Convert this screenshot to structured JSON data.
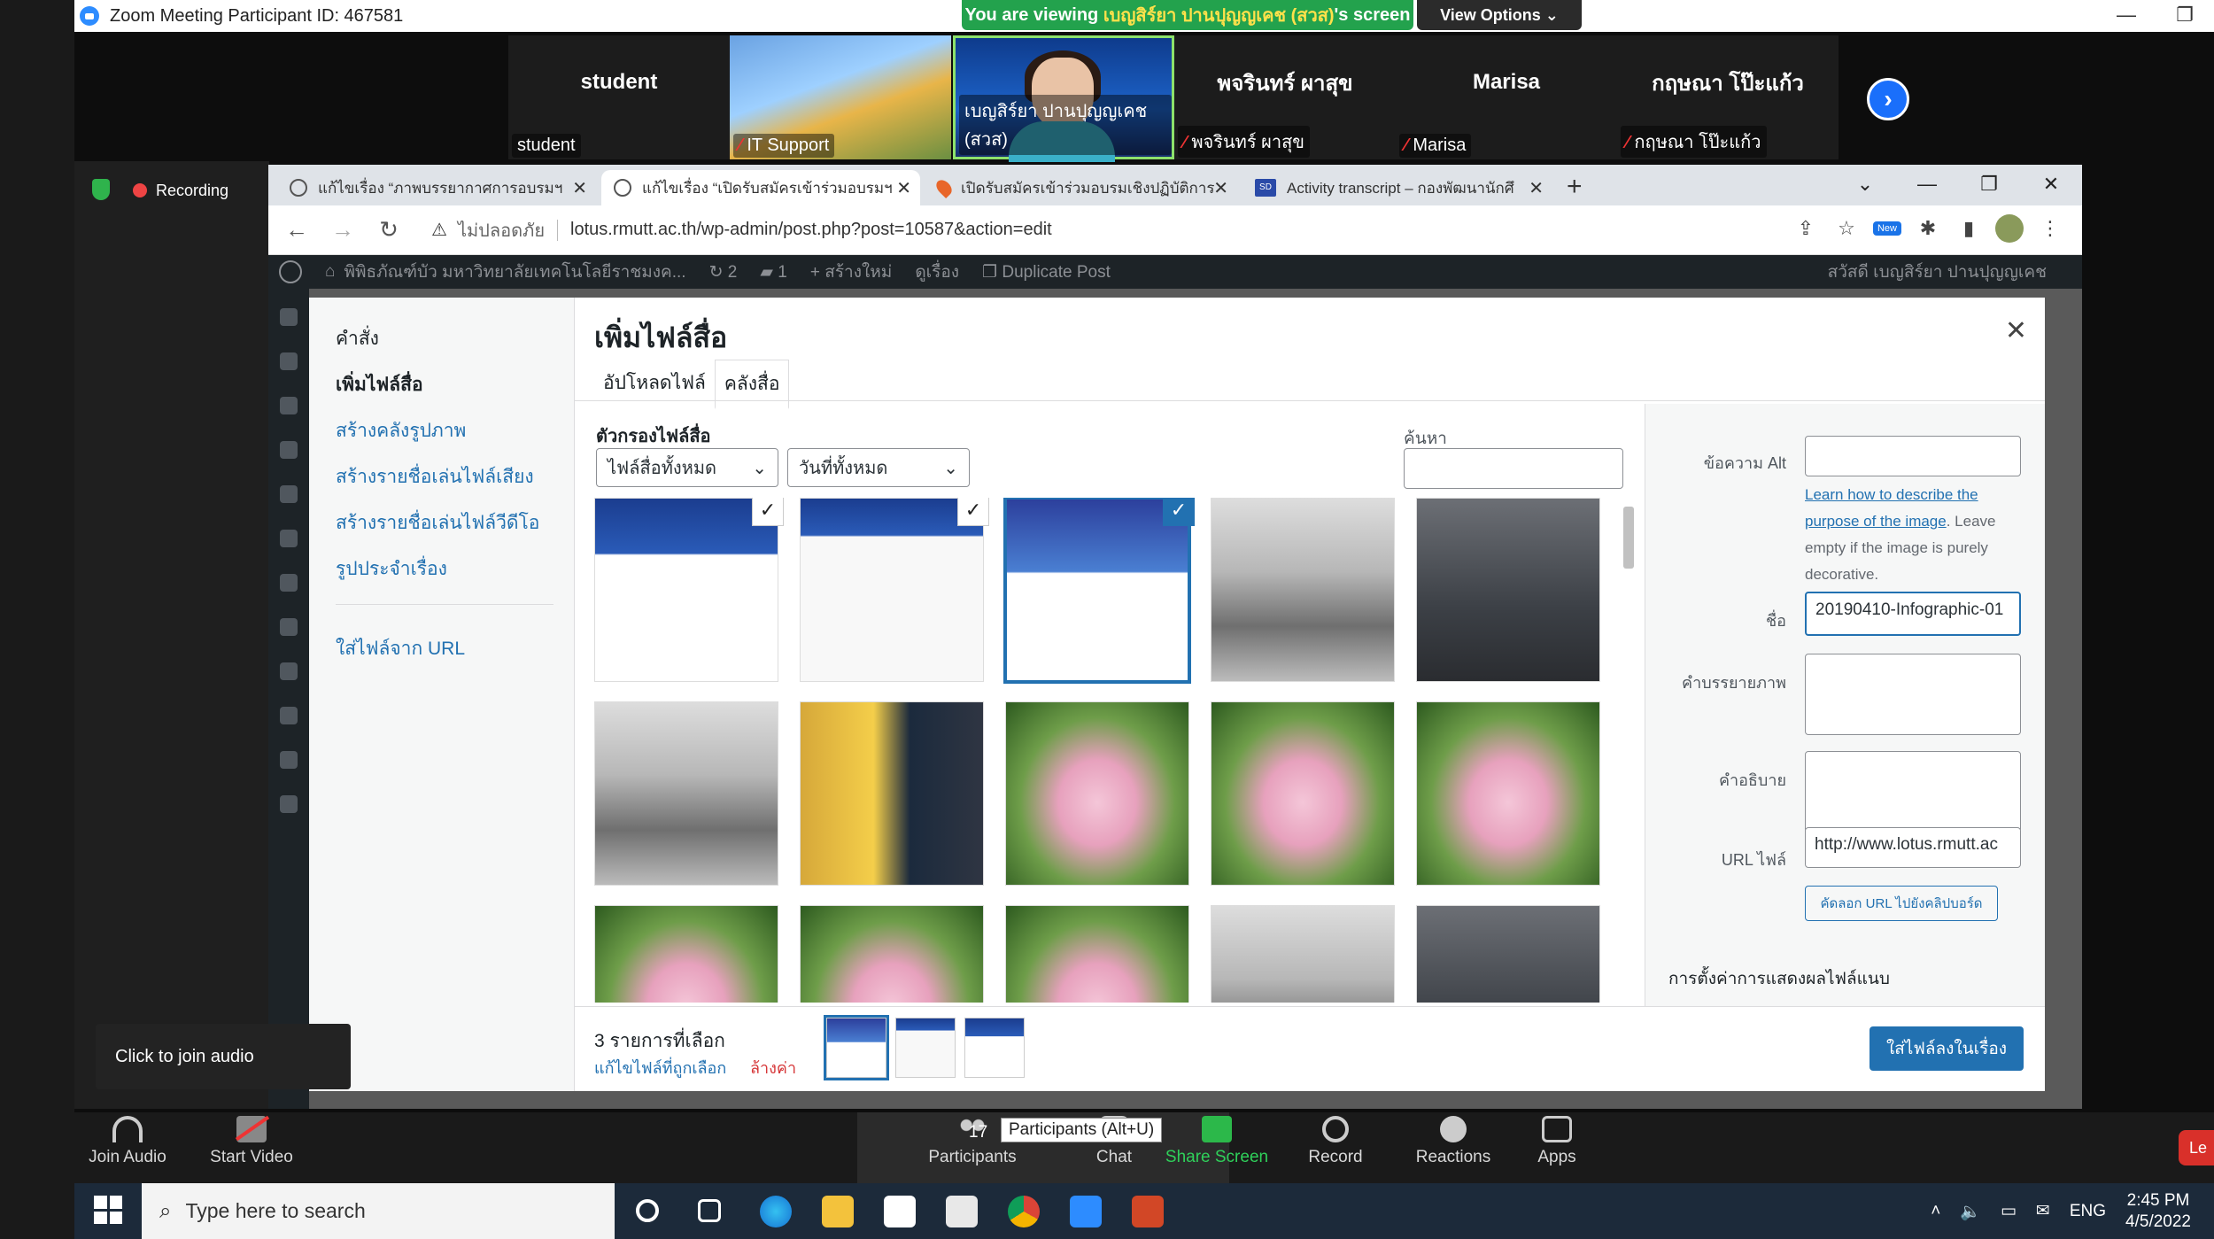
{
  "zoom": {
    "title": "Zoom Meeting Participant ID: 467581",
    "banner_prefix": "You are viewing",
    "banner_name": "เบญสิร์ยา ปานปุญญเคช (สวส)",
    "banner_suffix": "screen",
    "view_options": "View Options ⌄",
    "recording": "Recording",
    "participants": [
      {
        "big": "student",
        "label": "student"
      },
      {
        "big": "",
        "label": "IT Support"
      },
      {
        "big": "",
        "label": "เบญสิร์ยา ปานปุญญเคช (สวส)"
      },
      {
        "big": "พจรินทร์ ผาสุข",
        "label": "พจรินทร์ ผาสุข"
      },
      {
        "big": "Marisa",
        "label": "Marisa"
      },
      {
        "big": "กฤษณา โป๊ะแก้ว",
        "label": "กฤษณา โป๊ะแก้ว"
      }
    ],
    "join_tip": "Click to join audio",
    "toolbar": {
      "join_audio": "Join Audio",
      "start_video": "Start Video",
      "participants": "Participants",
      "participants_count": "17",
      "participants_tip": "Participants (Alt+U)",
      "chat": "Chat",
      "share": "Share Screen",
      "record": "Record",
      "reactions": "Reactions",
      "apps": "Apps",
      "leave": "Le"
    }
  },
  "browser": {
    "tabs": [
      {
        "title": "แก้ไขเรื่อง “ภาพบรรยากาศการอบรมฯ"
      },
      {
        "title": "แก้ไขเรื่อง “เปิดรับสมัครเข้าร่วมอบรมฯ"
      },
      {
        "title": "เปิดรับสมัครเข้าร่วมอบรมเชิงปฏิบัติการ"
      },
      {
        "title": "Activity transcript – กองพัฒนานักศึ"
      }
    ],
    "insecure": "ไม่ปลอดภัย",
    "url": "lotus.rmutt.ac.th/wp-admin/post.php?post=10587&action=edit",
    "new_badge": "New"
  },
  "wp": {
    "adminbar": {
      "site": "พิพิธภัณฑ์บัว มหาวิทยาลัยเทคโนโลยีราชมงค...",
      "updates": "2",
      "comments": "1",
      "new": "สร้างใหม่",
      "view": "ดูเรื่อง",
      "duplicate": "Duplicate Post",
      "greeting": "สวัสดี เบญสิร์ยา ปานปุญญเคช"
    },
    "modal": {
      "actions_heading": "คำสั่ง",
      "menu": [
        "เพิ่มไฟล์สื่อ",
        "สร้างคลังรูปภาพ",
        "สร้างรายชื่อเล่นไฟล์เสียง",
        "สร้างรายชื่อเล่นไฟล์วีดีโอ",
        "รูปประจำเรื่อง"
      ],
      "from_url": "ใส่ไฟล์จาก URL",
      "title": "เพิ่มไฟล์สื่อ",
      "tab_upload": "อัปโหลดไฟล์",
      "tab_library": "คลังสื่อ",
      "filter_label": "ตัวกรองไฟล์สื่อ",
      "filter_type": "ไฟล์สื่อทั้งหมด",
      "filter_date": "วันที่ทั้งหมด",
      "search_label": "ค้นหา",
      "details": {
        "alt_label": "ข้อความ Alt",
        "alt_help_link1": "Learn how to describe the",
        "alt_help_link2": "purpose of the image",
        "alt_help_rest": ". Leave empty if the image is purely decorative.",
        "title_label": "ชื่อ",
        "title_value": "20190410-Infographic-01",
        "caption_label": "คำบรรยายภาพ",
        "desc_label": "คำอธิบาย",
        "url_label": "URL ไฟล์",
        "url_value": "http://www.lotus.rmutt.ac",
        "copy_button": "คัดลอก URL ไปยังคลิปบอร์ด",
        "settings_heading": "การตั้งค่าการแสดงผลไฟล์แนบ"
      },
      "selection_count": "3 รายการที่เลือก",
      "edit_selection": "แก้ไขไฟล์ที่ถูกเลือก",
      "clear": "ล้างค่า",
      "insert_button": "ใส่ไฟล์ลงในเรื่อง"
    }
  },
  "taskbar": {
    "search_placeholder": "Type here to search",
    "lang": "ENG",
    "time": "2:45 PM",
    "date": "4/5/2022"
  }
}
